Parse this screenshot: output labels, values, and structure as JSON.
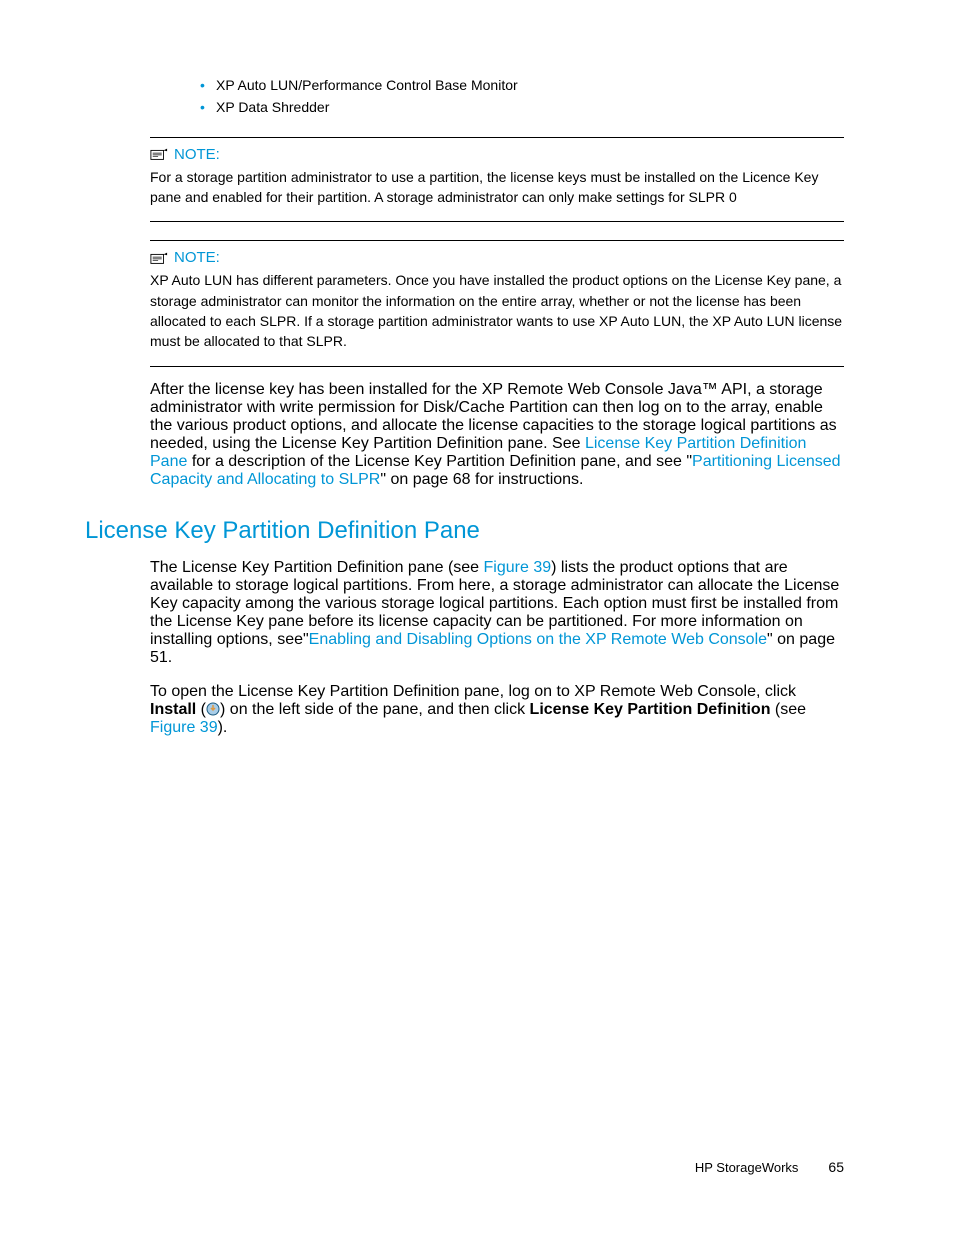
{
  "bullets": {
    "b1": "XP Auto LUN/Performance Control Base Monitor",
    "b2": "XP Data Shredder"
  },
  "notes": {
    "label": "NOTE:",
    "n1": "For a storage partition administrator to use a partition, the license keys must be installed on the Licence Key pane and enabled for their partition. A storage administrator can only make settings for SLPR 0",
    "n2": "XP Auto LUN has different parameters. Once you have installed the product options on the License Key pane, a storage administrator can monitor the information on the entire array, whether or not the license has been allocated to each SLPR. If a storage partition administrator wants to use XP Auto LUN, the XP Auto LUN license must be allocated to that SLPR."
  },
  "para1": {
    "t1": "After the license key has been installed for the XP Remote Web Console Java™ API, a storage administrator with write permission for Disk/Cache Partition can then log on to the array, enable the various product options, and allocate the license capacities to the storage logical partitions as needed, using the License Key Partition Definition pane. See ",
    "l1": "License Key Partition Definition Pane",
    "t2": " for a description of the License Key Partition Definition pane, and see \"",
    "l2": "Partitioning Licensed Capacity and Allocating to SLPR",
    "t3": "\" on page 68 for instructions."
  },
  "section": {
    "title": "License Key Partition Definition Pane"
  },
  "para2": {
    "t1": "The License Key Partition Definition pane (see ",
    "l1": "Figure 39",
    "t2": ") lists the product options that are available to storage logical partitions. From here, a storage administrator can allocate the License Key capacity among the various storage logical partitions. Each option must first be installed from the License Key pane before its license capacity can be partitioned. For more information on installing options, see\"",
    "l2": "Enabling and Disabling Options on the XP Remote Web Console",
    "t3": "\" on page 51."
  },
  "para3": {
    "t1": "To open the License Key Partition Definition pane, log on to XP Remote Web Console, click ",
    "b1": "Install",
    "t2": " (",
    "t3": ") on the left side of the pane, and then click ",
    "b2": "License Key Partition Definition",
    "t4": " (see ",
    "l1": "Figure 39",
    "t5": ")."
  },
  "footer": {
    "brand": "HP StorageWorks",
    "page": "65"
  }
}
